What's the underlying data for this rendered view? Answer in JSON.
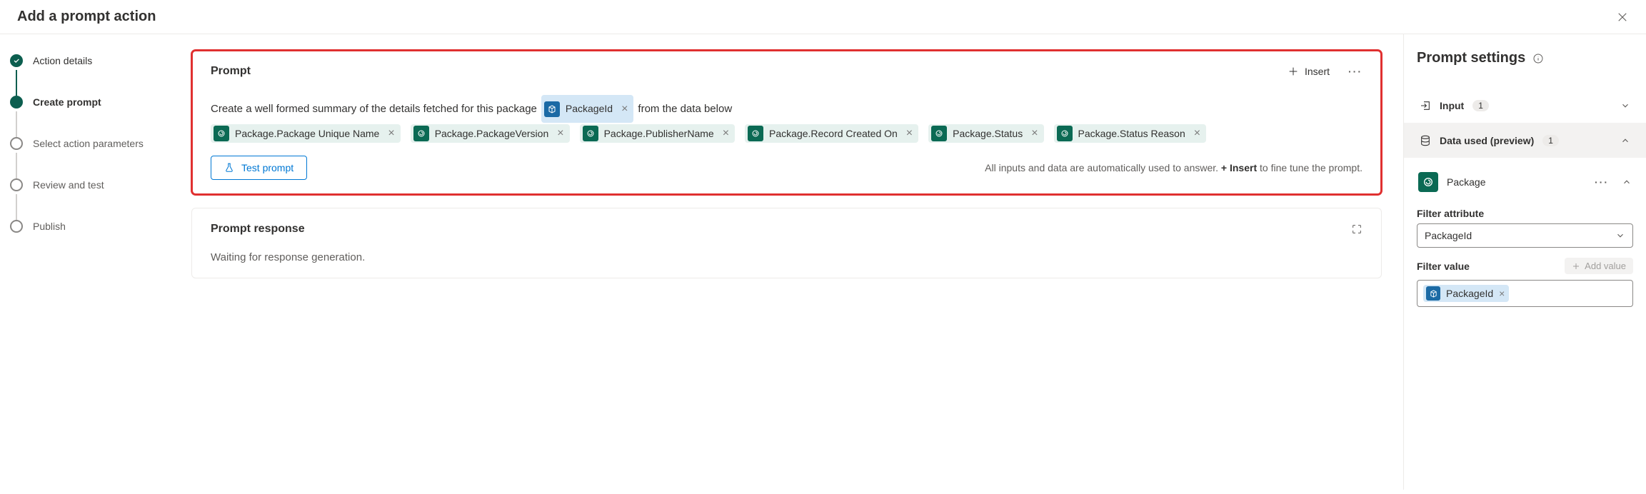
{
  "header": {
    "title": "Add a prompt action"
  },
  "steps": [
    {
      "label": "Action details"
    },
    {
      "label": "Create prompt"
    },
    {
      "label": "Select action parameters"
    },
    {
      "label": "Review and test"
    },
    {
      "label": "Publish"
    }
  ],
  "prompt": {
    "title": "Prompt",
    "insert_label": "Insert",
    "text_before": "Create a well formed summary of the details fetched for this package",
    "inline_chip": "PackageId",
    "text_after": "from the data below",
    "chips": [
      "Package.Package Unique Name",
      "Package.PackageVersion",
      "Package.PublisherName",
      "Package.Record Created On",
      "Package.Status",
      "Package.Status Reason"
    ],
    "test_label": "Test prompt",
    "hint_before": "All inputs and data are automatically used to answer. ",
    "hint_bold": "+ Insert",
    "hint_after": " to fine tune the prompt."
  },
  "response": {
    "title": "Prompt response",
    "body": "Waiting for response generation."
  },
  "settings": {
    "title": "Prompt settings",
    "input_label": "Input",
    "input_count": "1",
    "data_used_label": "Data used (preview)",
    "data_used_count": "1",
    "package_label": "Package",
    "filter_attribute_label": "Filter attribute",
    "filter_attribute_value": "PackageId",
    "filter_value_label": "Filter value",
    "add_value_label": "Add value",
    "filter_value_chip": "PackageId"
  }
}
